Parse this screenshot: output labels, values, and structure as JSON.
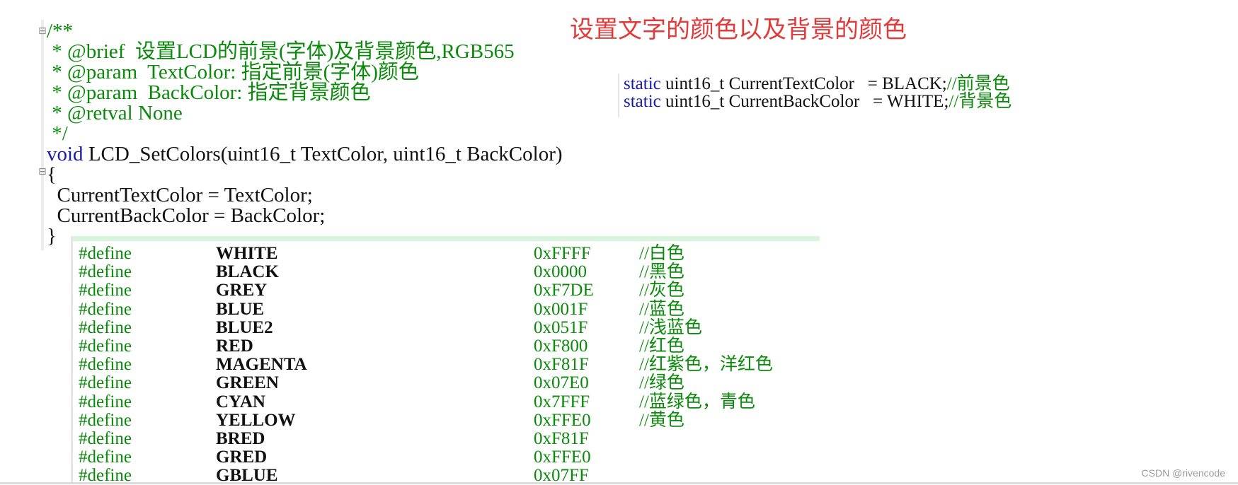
{
  "annotation": "设置文字的颜色以及背景的颜色",
  "fold_markers": [
    "⊟",
    "⊟"
  ],
  "code": {
    "comment_open": "/**",
    "brief": " * @brief  设置LCD的前景(字体)及背景颜色,RGB565",
    "param1": " * @param  TextColor: 指定前景(字体)颜色",
    "param2": " * @param  BackColor: 指定背景颜色",
    "retval": " * @retval None",
    "comment_close": " */",
    "signature_kw": "void",
    "signature_rest": " LCD_SetColors(uint16_t TextColor, uint16_t BackColor)",
    "brace_open": "{",
    "body1": "  CurrentTextColor = TextColor;",
    "body2": "  CurrentBackColor = BackColor;",
    "brace_close": "}"
  },
  "statics": [
    {
      "kw": "static",
      "rest": " uint16_t CurrentTextColor   = BLACK;",
      "comment": "//前景色"
    },
    {
      "kw": "static",
      "rest": " uint16_t CurrentBackColor   = WHITE;",
      "comment": "//背景色"
    }
  ],
  "defines": [
    {
      "kw": "#define",
      "name": "WHITE",
      "value": "0xFFFF",
      "comment": "//白色"
    },
    {
      "kw": "#define",
      "name": "BLACK",
      "value": "0x0000",
      "comment": "//黑色"
    },
    {
      "kw": "#define",
      "name": "GREY",
      "value": "0xF7DE",
      "comment": "//灰色"
    },
    {
      "kw": "#define",
      "name": "BLUE",
      "value": "0x001F",
      "comment": "//蓝色"
    },
    {
      "kw": "#define",
      "name": "BLUE2",
      "value": "0x051F",
      "comment": "//浅蓝色"
    },
    {
      "kw": "#define",
      "name": "RED",
      "value": "0xF800",
      "comment": "//红色"
    },
    {
      "kw": "#define",
      "name": "MAGENTA",
      "value": "0xF81F",
      "comment": "//红紫色，洋红色"
    },
    {
      "kw": "#define",
      "name": "GREEN",
      "value": "0x07E0",
      "comment": "//绿色"
    },
    {
      "kw": "#define",
      "name": "CYAN",
      "value": "0x7FFF",
      "comment": "//蓝绿色，青色"
    },
    {
      "kw": "#define",
      "name": "YELLOW",
      "value": "0xFFE0",
      "comment": "//黄色"
    },
    {
      "kw": "#define",
      "name": "BRED",
      "value": "0xF81F",
      "comment": ""
    },
    {
      "kw": "#define",
      "name": "GRED",
      "value": "0xFFE0",
      "comment": ""
    },
    {
      "kw": "#define",
      "name": "GBLUE",
      "value": "0x07FF",
      "comment": ""
    }
  ],
  "watermark": "CSDN @rivencode"
}
